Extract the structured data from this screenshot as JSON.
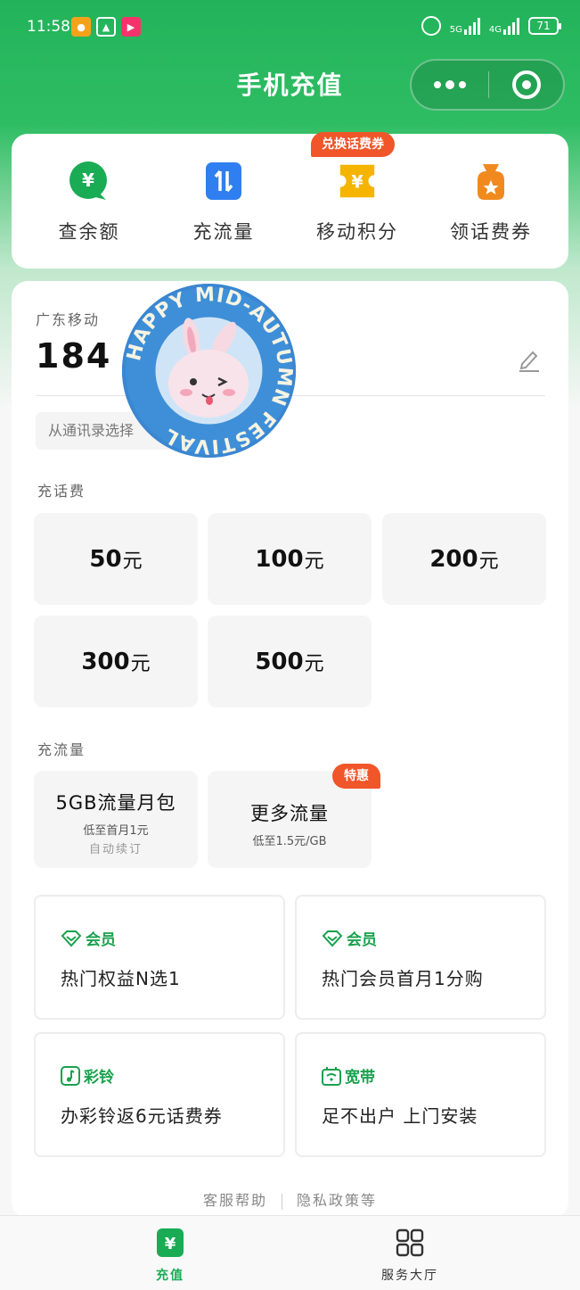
{
  "status_bar": {
    "time": "11:58",
    "network_5g": "5G",
    "network_4g": "4G",
    "battery": "71"
  },
  "header": {
    "title": "手机充值"
  },
  "quick_actions": {
    "promo_tag": "兑换话费券",
    "items": [
      {
        "label": "查余额",
        "icon": "yuan-search-icon",
        "color": "#1aab55"
      },
      {
        "label": "充流量",
        "icon": "data-transfer-icon",
        "color": "#2f7ff0"
      },
      {
        "label": "移动积分",
        "icon": "yuan-ticket-icon",
        "color": "#f5b400"
      },
      {
        "label": "领话费券",
        "icon": "coupon-bag-icon",
        "color": "#f08a1e"
      }
    ]
  },
  "account": {
    "carrier": "广东移动",
    "phone": "184 7",
    "contact_button": "从通讯录选择"
  },
  "sticker": {
    "text": "HAPPY MID-AUTUMN FESTIVAL"
  },
  "recharge": {
    "label": "充话费",
    "unit": "元",
    "amounts": [
      "50",
      "100",
      "200",
      "300",
      "500"
    ]
  },
  "data_plans": {
    "label": "充流量",
    "items": [
      {
        "title": "5GB流量月包",
        "sub": "低至首月1元",
        "sub2": "自动续订"
      },
      {
        "title": "更多流量",
        "sub": "低至1.5元/GB",
        "tag": "特惠"
      }
    ]
  },
  "benefits": [
    {
      "tag": "会员",
      "text": "热门权益N选1",
      "icon": "vip-diamond-icon"
    },
    {
      "tag": "会员",
      "text": "热门会员首月1分购",
      "icon": "vip-diamond-icon"
    },
    {
      "tag": "彩铃",
      "text": "办彩铃返6元话费券",
      "icon": "music-note-icon"
    },
    {
      "tag": "宽带",
      "text": "足不出户  上门安装",
      "icon": "wifi-router-icon"
    }
  ],
  "footer": {
    "help": "客服帮助",
    "privacy": "隐私政策等"
  },
  "tabbar": {
    "recharge": "充值",
    "services": "服务大厅"
  },
  "colors": {
    "brand_green": "#22b35a",
    "accent_orange": "#f0562a"
  }
}
